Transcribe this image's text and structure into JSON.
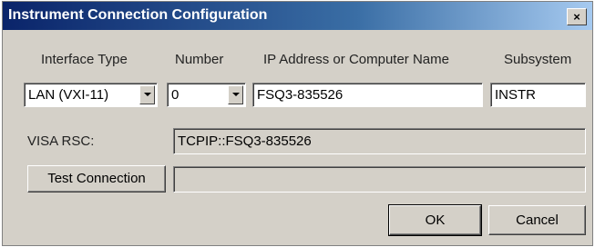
{
  "window": {
    "title": "Instrument Connection Configuration",
    "close_glyph": "✕"
  },
  "headers": {
    "interface_type": "Interface Type",
    "number": "Number",
    "ip_address": "IP Address or Computer Name",
    "subsystem": "Subsystem"
  },
  "fields": {
    "interface_type_value": "LAN (VXI-11)",
    "number_value": "0",
    "ip_address_value": "FSQ3-835526",
    "subsystem_value": "INSTR"
  },
  "visa": {
    "label": "VISA RSC:",
    "value": "TCPIP::FSQ3-835526"
  },
  "test": {
    "button_label": "Test Connection",
    "result": ""
  },
  "buttons": {
    "ok": "OK",
    "cancel": "Cancel"
  },
  "icons": {
    "close": "close-icon",
    "dropdown": "chevron-down-icon"
  }
}
